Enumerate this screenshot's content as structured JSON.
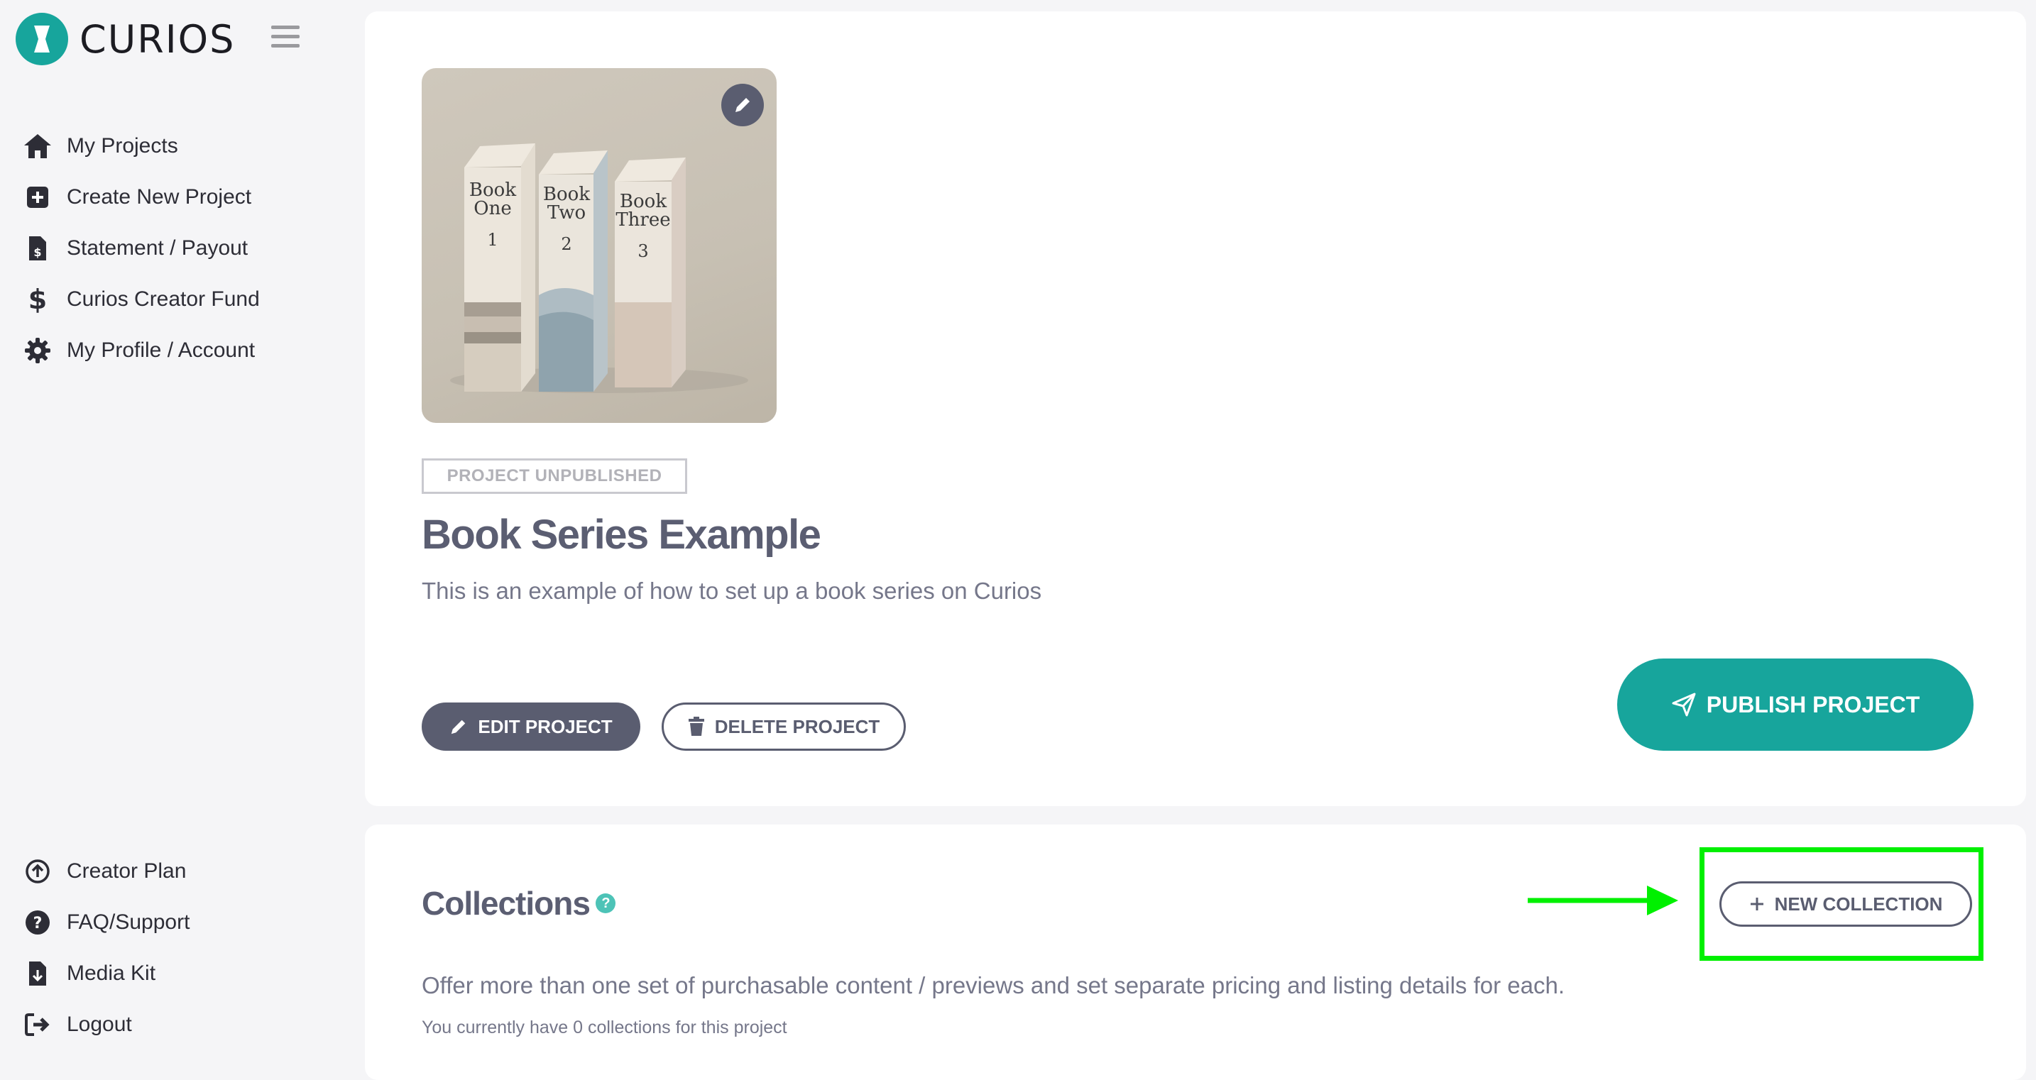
{
  "brand": {
    "name": "CURIOS",
    "color": "#17a59c"
  },
  "sidebar": {
    "items": [
      {
        "label": "My Projects",
        "icon": "home-icon"
      },
      {
        "label": "Create New Project",
        "icon": "plus-square-icon"
      },
      {
        "label": "Statement / Payout",
        "icon": "invoice-dollar-icon"
      },
      {
        "label": "Curios Creator Fund",
        "icon": "dollar-icon"
      },
      {
        "label": "My Profile / Account",
        "icon": "gear-icon"
      }
    ],
    "bottom_items": [
      {
        "label": "Creator Plan",
        "icon": "arrow-up-circle-icon"
      },
      {
        "label": "FAQ/Support",
        "icon": "question-circle-icon"
      },
      {
        "label": "Media Kit",
        "icon": "file-download-icon"
      },
      {
        "label": "Logout",
        "icon": "sign-out-icon"
      }
    ]
  },
  "project": {
    "status": "PROJECT UNPUBLISHED",
    "title": "Book Series Example",
    "description": "This is an example of how to set up a book series on Curios",
    "cover_books": [
      {
        "title_line1": "Book",
        "title_line2": "One",
        "number": "1"
      },
      {
        "title_line1": "Book",
        "title_line2": "Two",
        "number": "2"
      },
      {
        "title_line1": "Book",
        "title_line2": "Three",
        "number": "3"
      }
    ],
    "edit_label": "EDIT PROJECT",
    "delete_label": "DELETE PROJECT",
    "publish_label": "PUBLISH PROJECT"
  },
  "collections": {
    "title": "Collections",
    "help": "?",
    "new_label": "NEW COLLECTION",
    "description": "Offer more than one set of purchasable content / previews and set separate pricing and listing details for each.",
    "count_text": "You currently have 0 collections for this project"
  },
  "colors": {
    "accent": "#17a59c",
    "dark_button": "#5a5d70",
    "highlight": "#00f000"
  }
}
